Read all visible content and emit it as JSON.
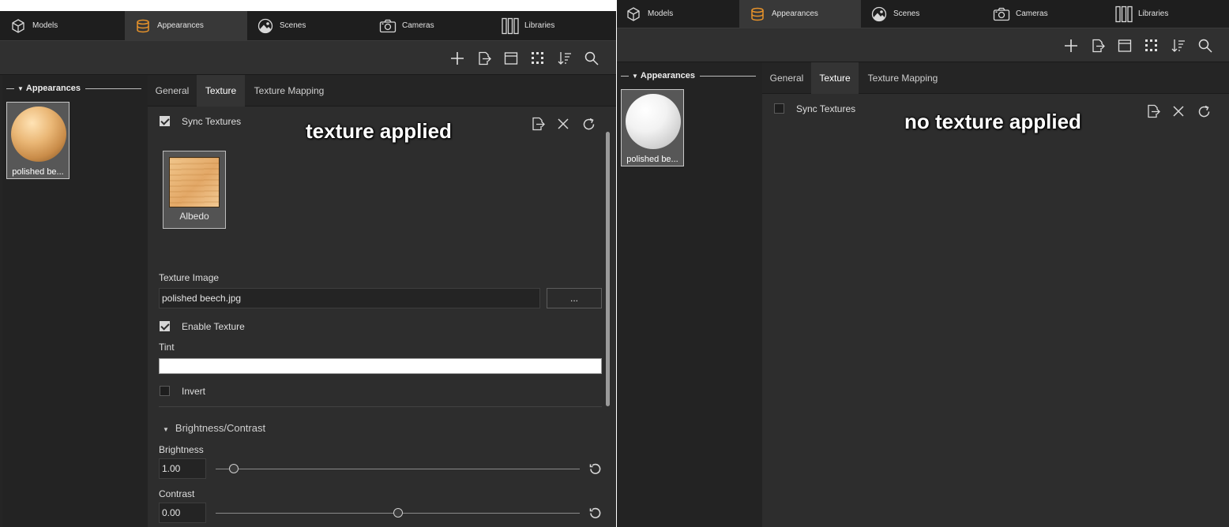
{
  "tabs": [
    {
      "label": "Models",
      "icon": "cube-icon"
    },
    {
      "label": "Appearances",
      "icon": "database-icon"
    },
    {
      "label": "Scenes",
      "icon": "scene-icon"
    },
    {
      "label": "Cameras",
      "icon": "camera-icon"
    },
    {
      "label": "Libraries",
      "icon": "libraries-icon"
    }
  ],
  "active_tab": "Appearances",
  "toolbar_icons": [
    "add-icon",
    "export-icon",
    "layout-icon",
    "grid-select-icon",
    "sort-icon",
    "search-icon"
  ],
  "sidebar": {
    "title": "Appearances"
  },
  "property_tabs": [
    "General",
    "Texture",
    "Texture Mapping"
  ],
  "active_property_tab": "Texture",
  "left_panel": {
    "overlay_text": "texture applied",
    "thumbnail_label": "polished be...",
    "sync_textures": {
      "label": "Sync Textures",
      "checked": true
    },
    "texture_slot_label": "Albedo",
    "texture_image": {
      "label": "Texture Image",
      "value": "polished beech.jpg",
      "browse_label": "..."
    },
    "enable_texture": {
      "label": "Enable Texture",
      "checked": true
    },
    "tint": {
      "label": "Tint",
      "color": "#ffffff"
    },
    "invert": {
      "label": "Invert",
      "checked": false
    },
    "brightness_contrast": {
      "section_label": "Brightness/Contrast",
      "brightness": {
        "label": "Brightness",
        "value": "1.00",
        "slider_fraction": 0.05
      },
      "contrast": {
        "label": "Contrast",
        "value": "0.00",
        "slider_fraction": 0.5
      }
    }
  },
  "right_panel": {
    "overlay_text": "no texture applied",
    "thumbnail_label": "polished be...",
    "sync_textures": {
      "label": "Sync Textures",
      "checked": false
    }
  },
  "colors": {
    "accent": "#e8932a",
    "panel_bg": "#2d2d2d",
    "active_tab_bg": "#383838"
  }
}
